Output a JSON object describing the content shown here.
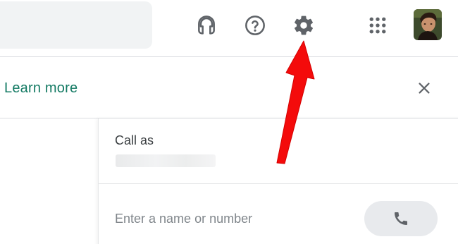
{
  "header": {
    "icons": {
      "support": "headset-icon",
      "help": "help-icon",
      "settings": "gear-icon",
      "apps": "apps-grid-icon",
      "avatar": "avatar"
    }
  },
  "banner": {
    "learn_more": "Learn more",
    "close_icon": "close-icon"
  },
  "call_panel": {
    "call_as_label": "Call as",
    "number_input": {
      "value": "",
      "placeholder": "Enter a name or number"
    },
    "call_button_icon": "phone-icon"
  },
  "colors": {
    "icon": "#5f6368",
    "link": "#137a63",
    "annotation_arrow": "#f40b0b",
    "search_bg": "#f1f3f4",
    "call_button_bg": "#e8eaed"
  }
}
